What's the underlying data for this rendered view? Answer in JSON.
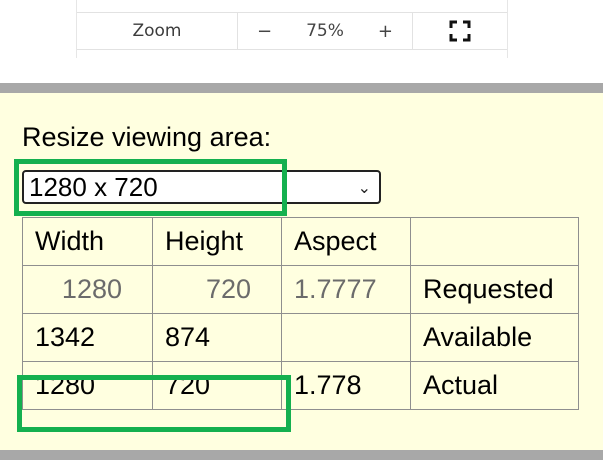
{
  "zoom": {
    "label": "Zoom",
    "decrease": "−",
    "value": "75%",
    "increase": "+",
    "fullscreen_icon": "fullscreen-icon"
  },
  "resize": {
    "title": "Resize viewing area:",
    "selected": "1280 x 720"
  },
  "table": {
    "headers": [
      "Width",
      "Height",
      "Aspect",
      ""
    ],
    "requested": {
      "width": "1280",
      "height": "720",
      "aspect": "1.7777",
      "label": "Requested"
    },
    "available": {
      "width": "1342",
      "height": "874",
      "aspect": "",
      "label": "Available"
    },
    "actual": {
      "width": "1280",
      "height": "720",
      "aspect": "1.778",
      "label": "Actual"
    }
  },
  "colors": {
    "panel_bg": "#ffffe0",
    "highlight": "#14b04f",
    "bar": "#a8a8a8"
  }
}
